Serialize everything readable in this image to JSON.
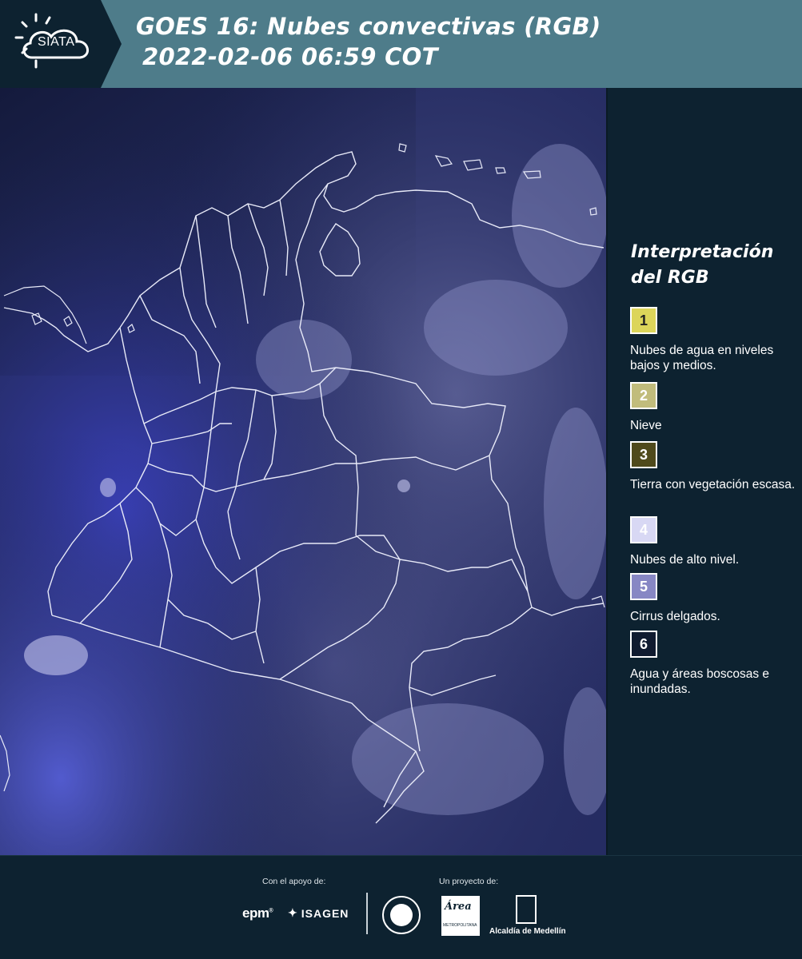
{
  "header": {
    "logo_text": "SIATA",
    "title_line1": "GOES 16: Nubes convectivas (RGB)",
    "title_line2": "2022-02-06 06:59 COT",
    "background_color": "#4e7c8a"
  },
  "map": {
    "description_icon": "satellite-rgb-map"
  },
  "legend": {
    "title_line1": "Interpretación",
    "title_line2": "del RGB",
    "items": [
      {
        "number": "1",
        "label": "Nubes de agua en niveles bajos y medios.",
        "color": "#dcd55a"
      },
      {
        "number": "2",
        "label": "Nieve",
        "color": "#c1bc7c"
      },
      {
        "number": "3",
        "label": "Tierra con vegetación escasa.",
        "color": "#4f4a1c"
      },
      {
        "number": "4",
        "label": "Nubes de alto nivel.",
        "color": "#d8d8f4"
      },
      {
        "number": "5",
        "label": "Cirrus delgados.",
        "color": "#8787c4"
      },
      {
        "number": "6",
        "label": "Agua y áreas boscosas e inundadas.",
        "color": "#101b30"
      }
    ]
  },
  "footer": {
    "support_label": "Con el apoyo de:",
    "project_label": "Un proyecto de:",
    "epm": "epm",
    "isagen": "ISAGEN",
    "area_text": "Área",
    "area_sub": "METROPOLITANA",
    "alcaldia": "Alcaldía de Medellín"
  }
}
